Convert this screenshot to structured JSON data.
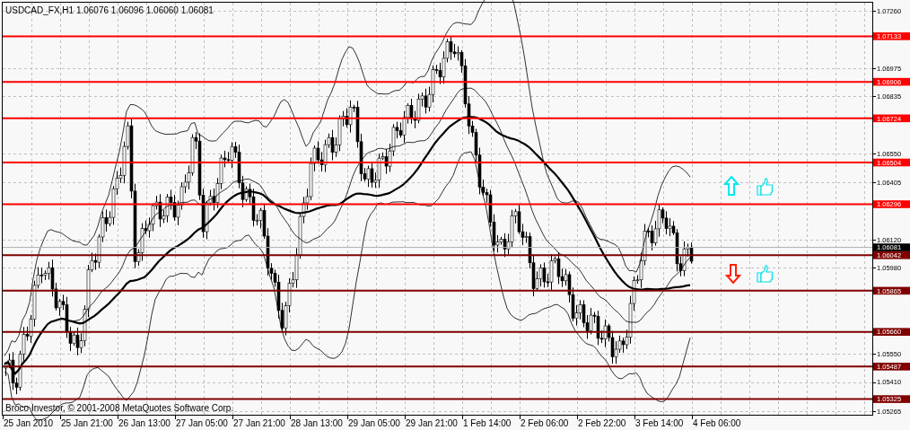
{
  "chart": {
    "symbol": "USDCAD_FX,H1",
    "ohlc": [
      "1.06076",
      "1.06096",
      "1.06060",
      "1.06081"
    ],
    "current_price": "1.06081",
    "price_axis": [
      "1.07260",
      "1.06975",
      "1.06835",
      "1.06550",
      "1.06405",
      "1.06120",
      "1.05980",
      "1.05550",
      "1.05410",
      "1.05265"
    ],
    "time_axis": [
      "25 Jan 2010",
      "25 Jan 21:00",
      "26 Jan 13:00",
      "27 Jan 05:00",
      "27 Jan 21:00",
      "28 Jan 13:00",
      "29 Jan 05:00",
      "29 Jan 21:00",
      "1 Feb 14:00",
      "2 Feb 06:00",
      "2 Feb 22:00",
      "3 Feb 14:00",
      "4 Feb 06:00"
    ],
    "levels": [
      {
        "price": "1.07133",
        "color": "#ff0000"
      },
      {
        "price": "1.06906",
        "color": "#ff0000"
      },
      {
        "price": "1.06724",
        "color": "#ff0000"
      },
      {
        "price": "1.06504",
        "color": "#ff0000"
      },
      {
        "price": "1.06296",
        "color": "#ff0000"
      },
      {
        "price": "1.06042",
        "color": "#800000"
      },
      {
        "price": "1.05865",
        "color": "#800000"
      },
      {
        "price": "1.05660",
        "color": "#800000"
      },
      {
        "price": "1.05487",
        "color": "#800000"
      },
      {
        "price": "1.05325",
        "color": "#800000"
      }
    ],
    "signals": [
      {
        "kind": "buy"
      },
      {
        "kind": "sell"
      }
    ],
    "copyright": "Broco Investor, © 2001-2008 MetaQuotes Software Corp."
  }
}
